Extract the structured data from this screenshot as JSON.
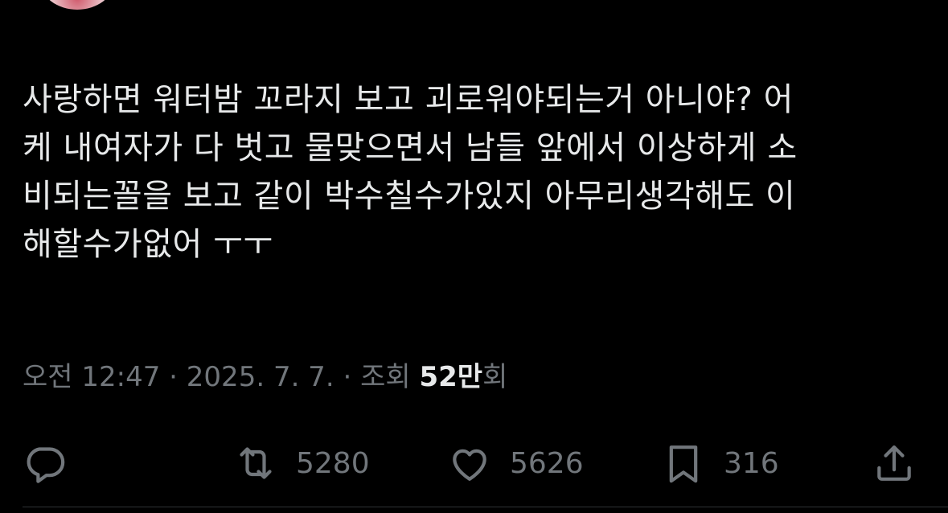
{
  "tweet": {
    "lines": [
      "사랑하면 워터밤 꼬라지 보고 괴로워야되는거 아니야? 어",
      "케 내여자가 다 벗고 물맞으면서 남들 앞에서 이상하게 소",
      "비되는꼴을 보고 같이 박수칠수가있지 아무리생각해도 이",
      "해할수가없어 ㅜㅜ"
    ]
  },
  "meta": {
    "time": "오전 12:47",
    "separator": "·",
    "date": "2025. 7. 7.",
    "views_label": "조회",
    "views_count": "52만",
    "views_suffix": "회"
  },
  "actions": {
    "reply": {
      "icon": "reply-icon",
      "count": ""
    },
    "retweet": {
      "icon": "retweet-icon",
      "count": "5280"
    },
    "like": {
      "icon": "heart-icon",
      "count": "5626"
    },
    "bookmark": {
      "icon": "bookmark-icon",
      "count": "316"
    },
    "share": {
      "icon": "share-icon",
      "count": ""
    }
  },
  "colors": {
    "background": "#000000",
    "text": "#e7e9ea",
    "secondary": "#71767b"
  }
}
